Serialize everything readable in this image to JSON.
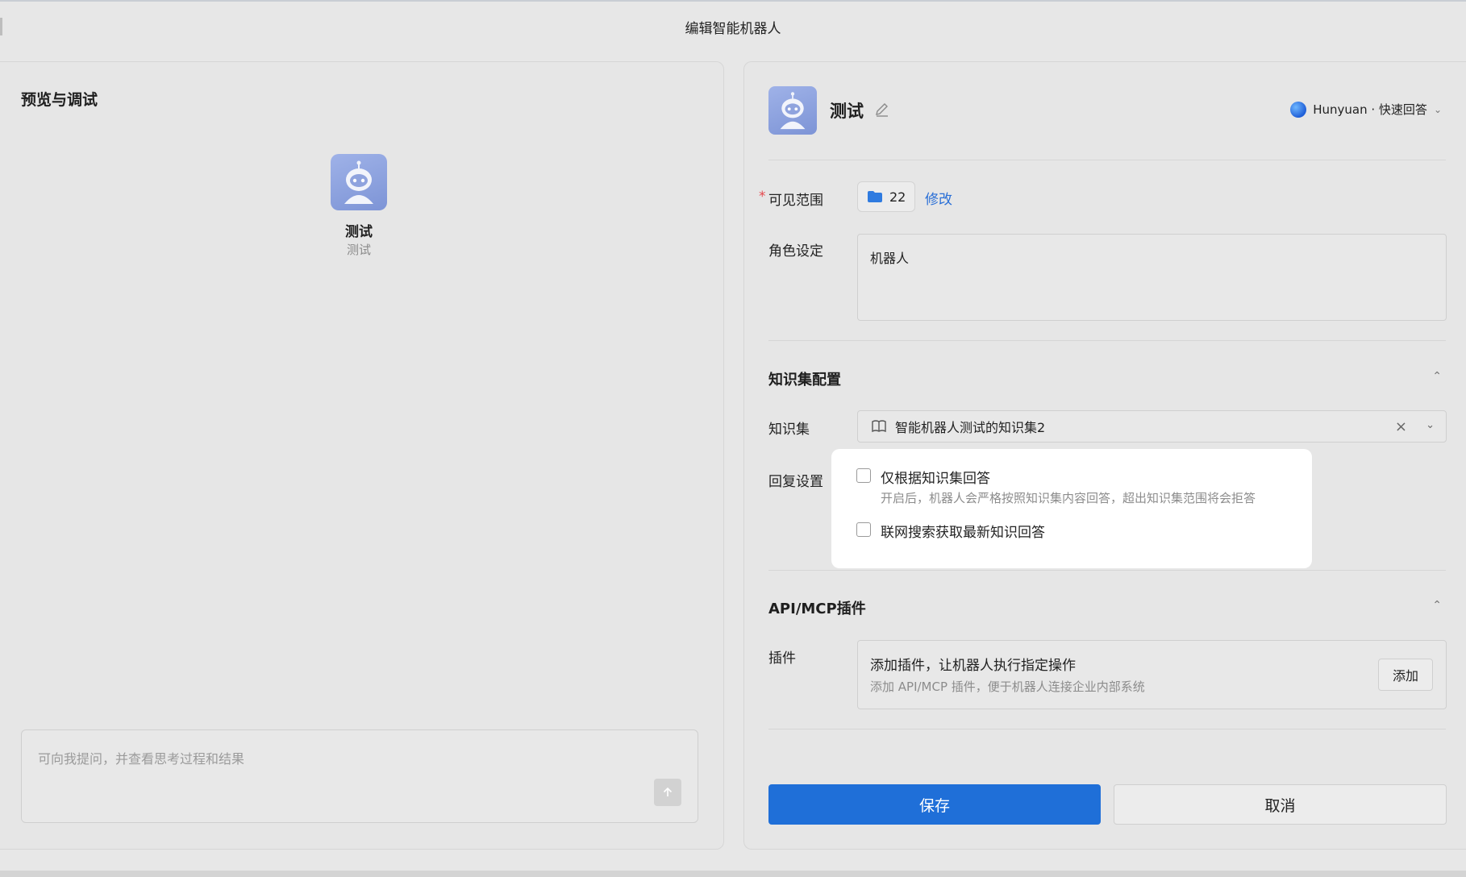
{
  "window": {
    "title": "编辑智能机器人"
  },
  "preview": {
    "title": "预览与调试",
    "bot_name": "测试",
    "bot_desc": "测试",
    "chat_placeholder": "可向我提问，并查看思考过程和结果"
  },
  "bot": {
    "name": "测试",
    "model": "Hunyuan · 快速回答"
  },
  "visibility": {
    "label": "可见范围",
    "required_mark": "*",
    "count": "22",
    "modify_label": "修改"
  },
  "role": {
    "label": "角色设定",
    "value": "机器人"
  },
  "knowledge": {
    "section_title": "知识集配置",
    "kb_label": "知识集",
    "kb_value": "智能机器人测试的知识集2",
    "reply_label": "回复设置",
    "option1_label": "仅根据知识集回答",
    "option1_hint": "开启后，机器人会严格按照知识集内容回答，超出知识集范围将会拒答",
    "option2_label": "联网搜索获取最新知识回答"
  },
  "plugins": {
    "section_title": "API/MCP插件",
    "label": "插件",
    "title": "添加插件，让机器人执行指定操作",
    "hint": "添加 API/MCP 插件，便于机器人连接企业内部系统",
    "add_label": "添加"
  },
  "actions": {
    "save_label": "保存",
    "cancel_label": "取消"
  },
  "colors": {
    "primary": "#1f6fd8",
    "link": "#2a6fd6",
    "required": "#e5484d"
  },
  "icons": {
    "edit": "pencil-icon",
    "folder": "folder-icon",
    "book": "book-icon",
    "clear": "close-icon",
    "chevron": "chevron-down-icon",
    "collapse": "chevron-up-icon",
    "send": "arrow-up-icon"
  }
}
